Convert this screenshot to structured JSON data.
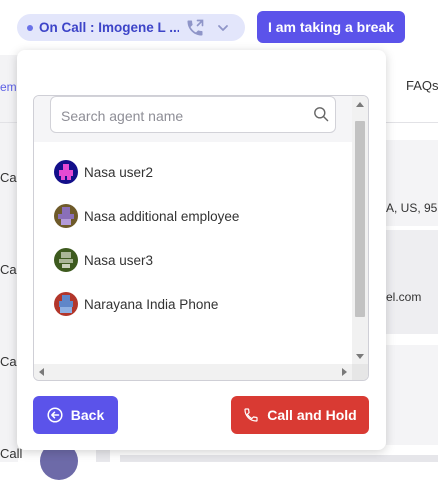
{
  "topbar": {
    "status_label": "On Call : Imogene L ...",
    "break_button": "I am taking a break"
  },
  "background": {
    "left_tab_partial": "emp",
    "faq_tab": "FAQs",
    "call_labels": [
      "Call",
      "Call",
      "Call",
      "Call"
    ],
    "right_text_1": "A, US, 95",
    "right_text_2": "el.com"
  },
  "transfer_panel": {
    "search_placeholder": "Search agent name",
    "agents": [
      {
        "name": "Nasa user2",
        "avatar_color": "#e44ad2"
      },
      {
        "name": "Nasa additional employee",
        "avatar_color": "#8a6fb8"
      },
      {
        "name": "Nasa user3",
        "avatar_color": "#a9b596"
      },
      {
        "name": "Narayana India Phone",
        "avatar_color": "#5f86c9"
      }
    ],
    "back_button": "Back",
    "call_hold_button": "Call and Hold"
  },
  "colors": {
    "primary": "#5b53ea",
    "danger": "#d93a33",
    "status_pill_bg": "#e3e6fb"
  }
}
